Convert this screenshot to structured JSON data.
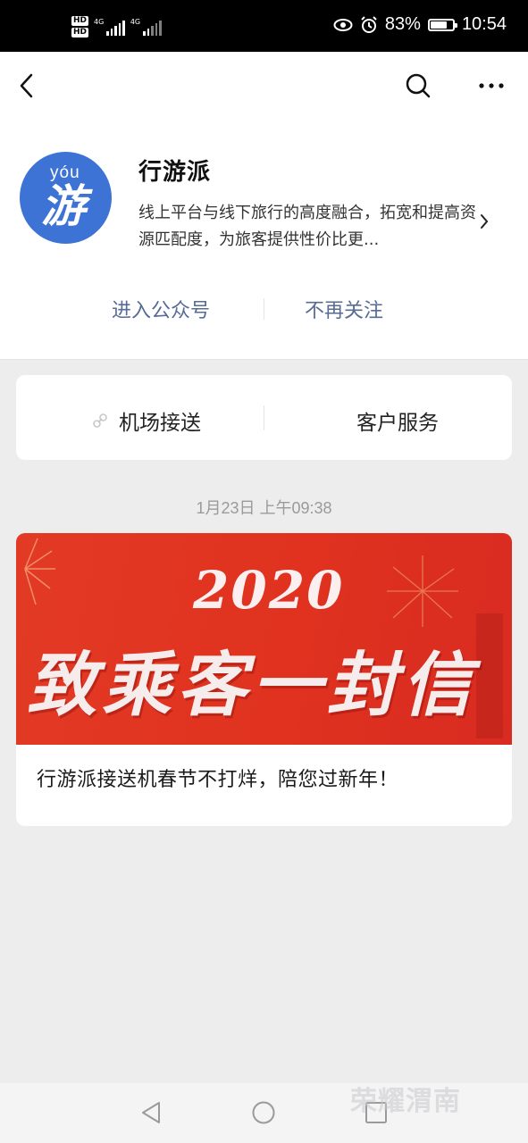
{
  "status_bar": {
    "hd_labels": [
      "HD",
      "HD"
    ],
    "sim_labels": [
      "4G",
      "4G"
    ],
    "battery_pct": 83,
    "battery_text": "83%",
    "time": "10:54"
  },
  "account": {
    "avatar_pinyin": "yóu",
    "avatar_char": "游",
    "name": "行游派",
    "description": "线上平台与线下旅行的高度融合，拓宽和提高资源匹配度，为旅客提供性价比更..."
  },
  "actions": {
    "enter": "进入公众号",
    "unfollow": "不再关注"
  },
  "menu": [
    {
      "label": "机场接送"
    },
    {
      "label": "客户服务"
    }
  ],
  "message": {
    "timestamp": "1月23日 上午09:38",
    "cover_year": "2020",
    "cover_text": "致乘客一封信",
    "title": "行游派接送机春节不打烊，陪您过新年！"
  },
  "watermark": "荣耀渭南",
  "colors": {
    "link_blue": "#576b95",
    "avatar_blue": "#3e73d6",
    "cover_red": "#e0321f"
  }
}
